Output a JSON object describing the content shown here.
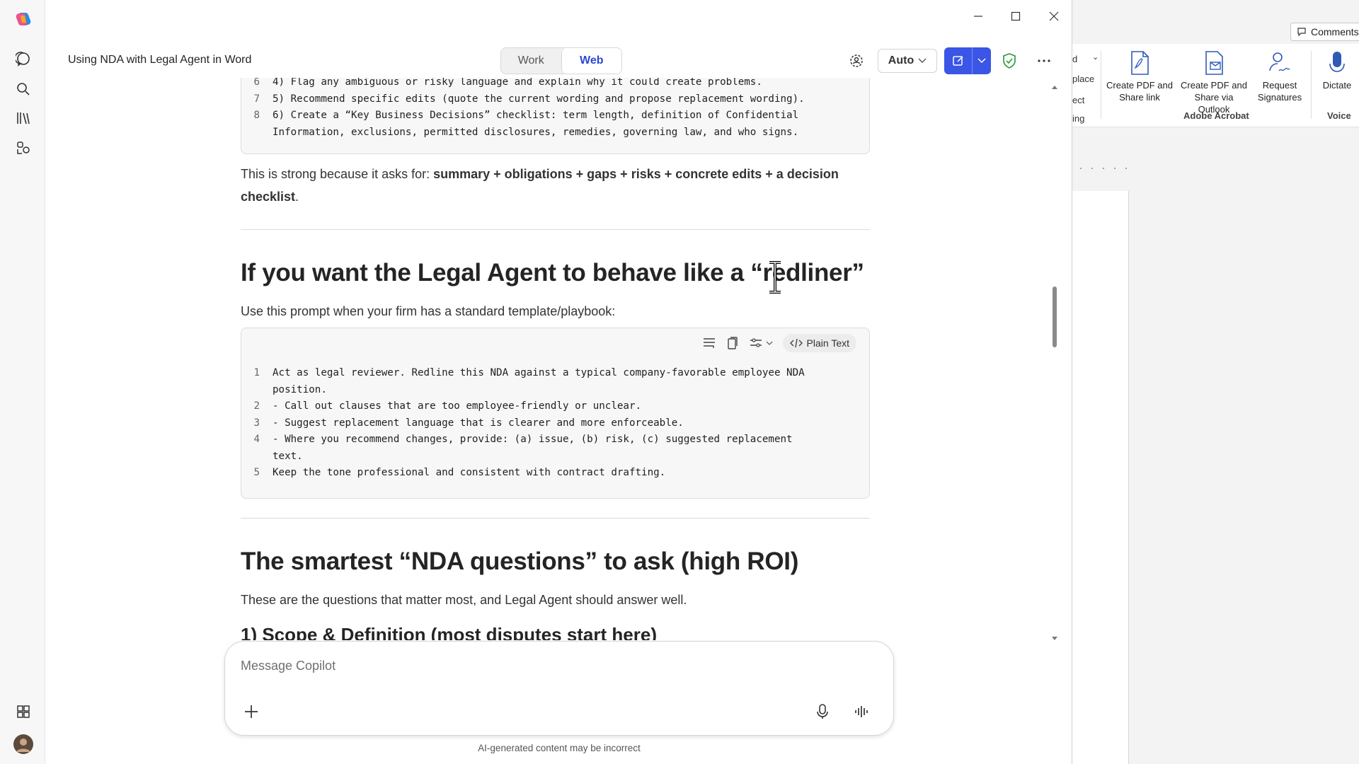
{
  "app": {
    "title": "Using NDA with Legal Agent in Word",
    "mode_tabs": [
      "Work",
      "Web"
    ],
    "active_mode": "Web",
    "model_select": "Auto"
  },
  "rail": {
    "icons": [
      "copilot-logo-icon",
      "chat-icon",
      "search-icon",
      "library-icon",
      "agents-icon",
      "apps-icon",
      "avatar"
    ]
  },
  "content": {
    "prev_code_lines": [
      {
        "num": "6",
        "text": "4) Flag any ambiguous or risky language and explain why it could create problems."
      },
      {
        "num": "7",
        "text": "5) Recommend specific edits (quote the current wording and propose replacement wording)."
      },
      {
        "num": "8",
        "text": "6) Create a “Key Business Decisions” checklist: term length, definition of Confidential\nInformation, exclusions, permitted disclosures, remedies, governing law, and who signs."
      }
    ],
    "strong_prefix": "This is strong because it asks for: ",
    "strong_bold": "summary + obligations + gaps + risks + concrete edits + a decision checklist",
    "strong_suffix": ".",
    "heading_redliner": "If you want the Legal Agent to behave like a “redliner”",
    "redliner_intro": "Use this prompt when your firm has a standard template/playbook:",
    "code_toolbar_label": "Plain Text",
    "redliner_code_lines": [
      {
        "num": "1",
        "text": "Act as legal reviewer. Redline this NDA against a typical company-favorable employee NDA\nposition."
      },
      {
        "num": "2",
        "text": "- Call out clauses that are too employee-friendly or unclear."
      },
      {
        "num": "3",
        "text": "- Suggest replacement language that is clearer and more enforceable."
      },
      {
        "num": "4",
        "text": "- Where you recommend changes, provide: (a) issue, (b) risk, (c) suggested replacement\ntext."
      },
      {
        "num": "5",
        "text": "Keep the tone professional and consistent with contract drafting."
      }
    ],
    "heading_questions": "The smartest “NDA questions” to ask (high ROI)",
    "questions_intro": "These are the questions that matter most, and Legal Agent should answer well.",
    "subheading_scope": "1) Scope & Definition (most disputes start here)"
  },
  "composer": {
    "placeholder": "Message Copilot",
    "disclaimer": "AI-generated content may be incorrect"
  },
  "word": {
    "comments_label": "Comments",
    "ribbon_fragments": [
      "d",
      "place",
      "ect",
      "ing"
    ],
    "ribbon_buttons": [
      {
        "label": "Create PDF and Share link",
        "icon": "pdf-share-icon"
      },
      {
        "label": "Create PDF and Share via Outlook",
        "icon": "pdf-outlook-icon"
      },
      {
        "label": "Request Signatures",
        "icon": "signature-icon"
      },
      {
        "label": "Dictate",
        "icon": "microphone-icon"
      }
    ],
    "ribbon_groups": [
      "Adobe Acrobat",
      "Voice"
    ]
  },
  "colors": {
    "accent": "#3b55e6",
    "web_tab": "#2b47d6",
    "shield": "#2e9e3b"
  }
}
